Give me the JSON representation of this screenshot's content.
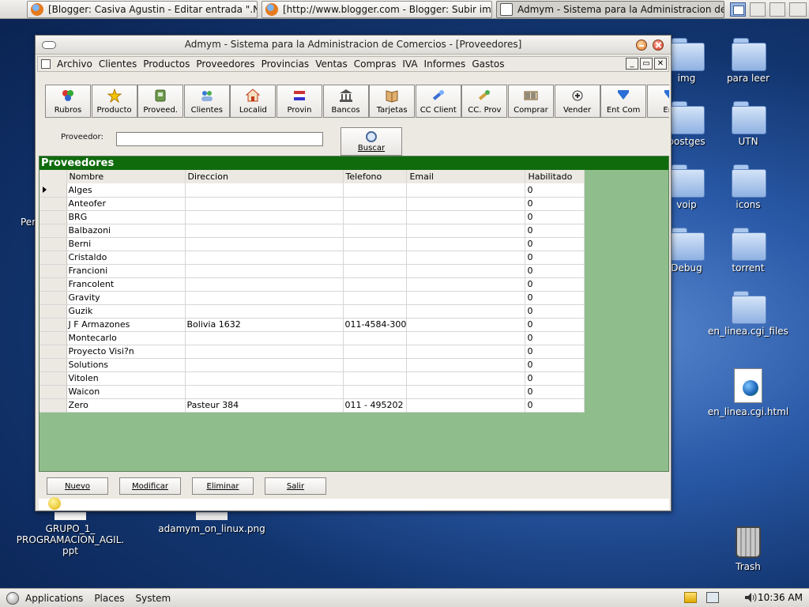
{
  "taskbar": {
    "tasks": [
      {
        "label": "[Blogger: Casiva Agustin - Editar entrada \".NE..."
      },
      {
        "label": "[http://www.blogger.com - Blogger: Subir im..."
      },
      {
        "label": "Admym - Sistema para la Administracion de ..."
      }
    ]
  },
  "desktop": {
    "icons": [
      {
        "label": "img"
      },
      {
        "label": "para leer"
      },
      {
        "label": "postges"
      },
      {
        "label": "UTN"
      },
      {
        "label": "voip"
      },
      {
        "label": "icons"
      },
      {
        "label": "Debug"
      },
      {
        "label": "torrent"
      },
      {
        "label": "en_linea.cgi_files"
      },
      {
        "label": "en_linea.cgi.html"
      },
      {
        "label": "Trash"
      },
      {
        "label": "GRUPO_1_ PROGRAMACION_AGIL. ppt"
      },
      {
        "label": "adamym_on_linux.png"
      },
      {
        "label": "Per"
      }
    ]
  },
  "window": {
    "title": "Admym - Sistema para la Administracion de Comercios - [Proveedores]",
    "menu": [
      "Archivo",
      "Clientes",
      "Productos",
      "Proveedores",
      "Provincias",
      "Ventas",
      "Compras",
      "IVA",
      "Informes",
      "Gastos"
    ],
    "toolbar": [
      {
        "label": "Rubros",
        "icon": "rubros-icon"
      },
      {
        "label": "Producto",
        "icon": "star-icon"
      },
      {
        "label": "Proveed.",
        "icon": "proveedor-icon"
      },
      {
        "label": "Clientes",
        "icon": "clients-icon"
      },
      {
        "label": "Localid",
        "icon": "house-icon"
      },
      {
        "label": "Provin",
        "icon": "flag-icon"
      },
      {
        "label": "Bancos",
        "icon": "bank-icon"
      },
      {
        "label": "Tarjetas",
        "icon": "cards-icon"
      },
      {
        "label": "CC Client",
        "icon": "cc-client-icon"
      },
      {
        "label": "CC. Prov",
        "icon": "cc-prov-icon"
      },
      {
        "label": "Comprar",
        "icon": "barcode-icon"
      },
      {
        "label": "Vender",
        "icon": "vender-icon"
      },
      {
        "label": "Ent Com",
        "icon": "arrow-down-icon"
      },
      {
        "label": "Ent",
        "icon": "arrow-down-icon"
      }
    ],
    "search": {
      "label": "Proveedor:",
      "value": "",
      "button_label": "Buscar"
    },
    "grid": {
      "title": "Proveedores",
      "columns": [
        "Nombre",
        "Direccion",
        "Telefono",
        "Email",
        "Habilitado"
      ],
      "rows": [
        [
          "Alges",
          "",
          "",
          "",
          "0"
        ],
        [
          "Anteofer",
          "",
          "",
          "",
          "0"
        ],
        [
          "BRG",
          "",
          "",
          "",
          "0"
        ],
        [
          "Balbazoni",
          "",
          "",
          "",
          "0"
        ],
        [
          "Berni",
          "",
          "",
          "",
          "0"
        ],
        [
          "Cristaldo",
          "",
          "",
          "",
          "0"
        ],
        [
          "Francioni",
          "",
          "",
          "",
          "0"
        ],
        [
          "Francolent",
          "",
          "",
          "",
          "0"
        ],
        [
          "Gravity",
          "",
          "",
          "",
          "0"
        ],
        [
          "Guzik",
          "",
          "",
          "",
          "0"
        ],
        [
          "J F Armazones",
          "Bolivia 1632",
          "011-4584-300",
          "",
          "0"
        ],
        [
          "Montecarlo",
          "",
          "",
          "",
          "0"
        ],
        [
          "Proyecto Visi?n",
          "",
          "",
          "",
          "0"
        ],
        [
          "Solutions",
          "",
          "",
          "",
          "0"
        ],
        [
          "Vitolen",
          "",
          "",
          "",
          "0"
        ],
        [
          "Waicon",
          "",
          "",
          "",
          "0"
        ],
        [
          "Zero",
          "Pasteur 384",
          "011 - 495202",
          "",
          "0"
        ]
      ]
    },
    "actions": {
      "nuevo": "Nuevo",
      "modificar": "Modificar",
      "eliminar": "Eliminar",
      "salir": "Salir"
    }
  },
  "panel": {
    "applications": "Applications",
    "places": "Places",
    "system": "System",
    "clock": "10:36 AM"
  }
}
